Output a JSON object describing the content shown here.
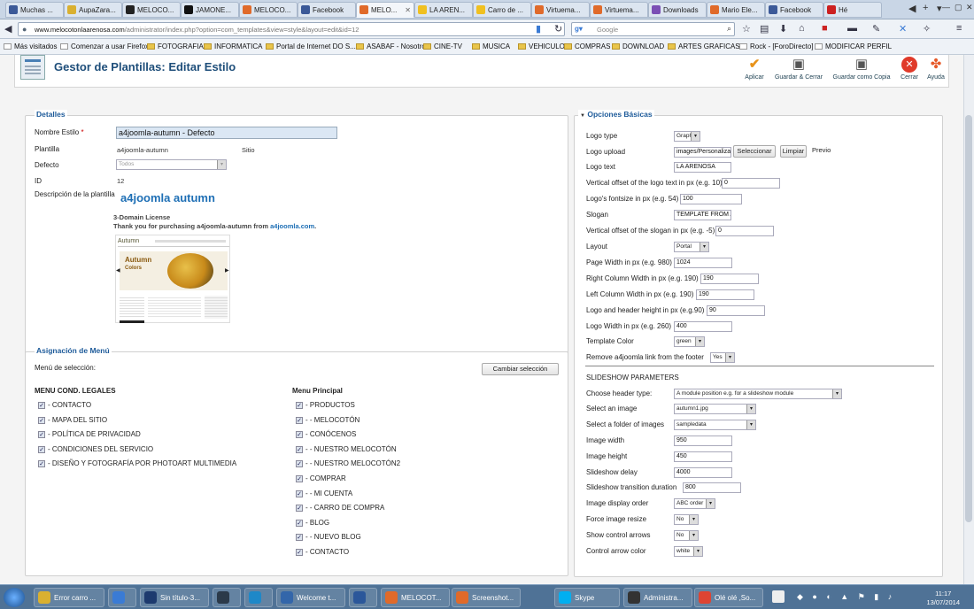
{
  "browser": {
    "tabs": [
      {
        "label": "Muchas ...",
        "color": "#3b5998"
      },
      {
        "label": "AupaZara...",
        "color": "#d9b030"
      },
      {
        "label": "MELOCO...",
        "color": "#222222"
      },
      {
        "label": "JAMONE...",
        "color": "#111111"
      },
      {
        "label": "MELOCO...",
        "color": "#e06a2a"
      },
      {
        "label": "Facebook",
        "color": "#3b5998"
      },
      {
        "label": "MELO...",
        "color": "#e06a2a",
        "active": true
      },
      {
        "label": "LA AREN...",
        "color": "#f0c020"
      },
      {
        "label": "Carro de ...",
        "color": "#f0c020"
      },
      {
        "label": "Virtuema...",
        "color": "#e06a2a"
      },
      {
        "label": "Virtuema...",
        "color": "#e06a2a"
      },
      {
        "label": "Downloads",
        "color": "#7b4fb5"
      },
      {
        "label": "Mario Ele...",
        "color": "#e06a2a"
      },
      {
        "label": "Facebook",
        "color": "#3b5998"
      },
      {
        "label": "Hé",
        "color": "#cc2020"
      }
    ],
    "url_domain": "www.melocotonlaarenosa.com",
    "url_rest": "/administrator/index.php?option=com_templates&view=style&layout=edit&id=12",
    "search_placeholder": "Google",
    "bookmarks": [
      "Más visitados",
      "Comenzar a usar Firefox",
      "FOTOGRAFIA",
      "INFORMATICA",
      "Portal de Internet DO S...",
      "ASABAF - Nosotros",
      "CINE-TV",
      "MUSICA",
      "VEHICULOS",
      "COMPRAS",
      "DOWNLOAD",
      "ARTES GRAFICAS",
      "Rock - [ForoDirecto]",
      "MODIFICAR PERFIL"
    ]
  },
  "header": {
    "title": "Gestor de Plantillas: Editar Estilo",
    "toolbar": {
      "apply": "Aplicar",
      "save_close": "Guardar & Cerrar",
      "save_copy": "Guardar como Copia",
      "close": "Cerrar",
      "help": "Ayuda"
    }
  },
  "details": {
    "legend": "Detalles",
    "style_name_label": "Nombre Estilo",
    "required_mark": "*",
    "style_name_value": "a4joomla-autumn - Defecto",
    "template_label": "Plantilla",
    "template_value": "a4joomla-autumn",
    "site_value": "Sitio",
    "default_label": "Defecto",
    "default_value": "Todos",
    "id_label": "ID",
    "id_value": "12",
    "description_label": "Descripción de la plantilla",
    "description_title": "a4joomla autumn",
    "license": "3-Domain License",
    "thanks": "Thank you for purchasing a4joomla-autumn from ",
    "thanks_link": "a4joomla.com",
    "thanks_end": ".",
    "preview_brand": "Autumn",
    "preview_banner_1": "Autumn",
    "preview_banner_2": "Colors"
  },
  "menu_assignment": {
    "legend": "Asignación de Menú",
    "selection_label": "Menú de selección:",
    "change_button": "Cambiar selección",
    "col1_title": "MENU COND. LEGALES",
    "col1_items": [
      "- CONTACTO",
      "- MAPA DEL SITIO",
      "- POLÍTICA DE PRIVACIDAD",
      "- CONDICIONES DEL SERVICIO",
      "- DISEÑO Y FOTOGRAFÍA POR PHOTOART MULTIMEDIA"
    ],
    "col2_title": "Menu Principal",
    "col2_items": [
      "- PRODUCTOS",
      "- - MELOCOTÓN",
      "- CONÓCENOS",
      "- - NUESTRO MELOCOTÓN",
      "- - NUESTRO MELOCOTÓN2",
      "- COMPRAR",
      "- - MI CUENTA",
      "- - CARRO DE COMPRA",
      "- BLOG",
      "- - NUEVO BLOG",
      "- CONTACTO"
    ]
  },
  "basic_options": {
    "legend": "Opciones Básicas",
    "collapse_marker": "▼",
    "logo_type_label": "Logo type",
    "logo_type_value": "Graphic",
    "logo_upload_label": "Logo upload",
    "logo_upload_value": "images/Personalizaci",
    "select_button": "Seleccionar",
    "clear_button": "Limpiar",
    "preview_label": "Previo",
    "logo_text_label": "Logo text",
    "logo_text_value": "LA ARENOSA",
    "logo_offset_label": "Vertical offset of the logo text in px (e.g. 10)",
    "logo_offset_value": "0",
    "logo_fontsize_label": "Logo's fontsize in px (e.g. 54)",
    "logo_fontsize_value": "100",
    "slogan_label": "Slogan",
    "slogan_value": "TEMPLATE FROM A",
    "slogan_offset_label": "Vertical offset of the slogan in px (e.g. -5)",
    "slogan_offset_value": "0",
    "layout_label": "Layout",
    "layout_value": "Portal",
    "page_width_label": "Page Width in px (e.g. 980)",
    "page_width_value": "1024",
    "right_col_label": "Right Column Width in px (e.g. 190)",
    "right_col_value": "190",
    "left_col_label": "Left Column Width in px (e.g. 190)",
    "left_col_value": "190",
    "logo_header_height_label": "Logo and header height in px (e.g.90)",
    "logo_header_height_value": "90",
    "logo_width_label": "Logo Width in px (e.g. 260)",
    "logo_width_value": "400",
    "template_color_label": "Template Color",
    "template_color_value": "green",
    "remove_link_label": "Remove a4joomla link from the footer",
    "remove_link_value": "Yes",
    "slideshow_title": "SLIDESHOW PARAMETERS",
    "header_type_label": "Choose header type:",
    "header_type_value": "A module position e.g. for a slideshow module",
    "select_image_label": "Select an image",
    "select_image_value": "autumn1.jpg",
    "folder_label": "Select a folder of images",
    "folder_value": "sampledata",
    "image_width_label": "Image width",
    "image_width_value": "950",
    "image_height_label": "Image height",
    "image_height_value": "450",
    "delay_label": "Slideshow delay",
    "delay_value": "4000",
    "transition_label": "Slideshow transition duration",
    "transition_value": "800",
    "display_order_label": "Image display order",
    "display_order_value": "ABC order",
    "force_resize_label": "Force image resize",
    "force_resize_value": "No",
    "show_arrows_label": "Show control arrows",
    "show_arrows_value": "No",
    "arrow_color_label": "Control arrow color",
    "arrow_color_value": "white"
  },
  "taskbar": {
    "items": [
      {
        "label": "Error carro ...",
        "color": "#d9b030"
      },
      {
        "label": "",
        "color": "#3a7bd5"
      },
      {
        "label": "Sin título-3...",
        "color": "#1d3a6e"
      },
      {
        "label": "",
        "color": "#2b3a4a"
      },
      {
        "label": "",
        "color": "#1e88c8"
      },
      {
        "label": "Welcome t...",
        "color": "#3366aa"
      },
      {
        "label": "",
        "color": "#2b579a"
      },
      {
        "label": "MELOCOT...",
        "color": "#e06a2a"
      },
      {
        "label": "Screenshot...",
        "color": "#e06a2a"
      },
      {
        "label": "Skype",
        "color": "#00aff0"
      },
      {
        "label": "Administra...",
        "color": "#333333"
      },
      {
        "label": "Olé olé ,So...",
        "color": "#dd4433"
      }
    ],
    "time": "11:17",
    "date": "13/07/2014"
  }
}
